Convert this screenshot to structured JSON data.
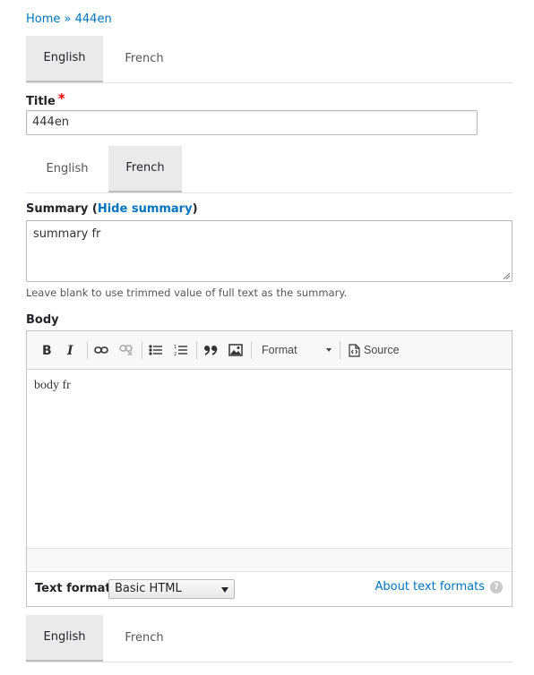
{
  "breadcrumb": {
    "home": "Home",
    "separator": "»",
    "current": "444en"
  },
  "tabs_top": [
    {
      "label": "English",
      "active": true
    },
    {
      "label": "French",
      "active": false
    }
  ],
  "title_field": {
    "label": "Title",
    "required_mark": "*",
    "value": "444en"
  },
  "tabs_mid": [
    {
      "label": "English",
      "active": false
    },
    {
      "label": "French",
      "active": true
    }
  ],
  "summary_field": {
    "label_prefix": "Summary (",
    "toggle_link": "Hide summary",
    "label_suffix": ")",
    "value": "summary fr",
    "description": "Leave blank to use trimmed value of full text as the summary."
  },
  "body_field": {
    "label": "Body",
    "toolbar": {
      "format_label": "Format",
      "source_label": "Source"
    },
    "content": "body fr",
    "text_format_label": "Text format",
    "text_format_selected": "Basic HTML",
    "about_formats_link": "About text formats",
    "help_glyph": "?"
  },
  "tabs_bottom": [
    {
      "label": "English",
      "active": true
    },
    {
      "label": "French",
      "active": false
    }
  ],
  "colors": {
    "link": "#0074bd",
    "required": "#ee0000",
    "active_tab_bg": "#eaeaea"
  }
}
